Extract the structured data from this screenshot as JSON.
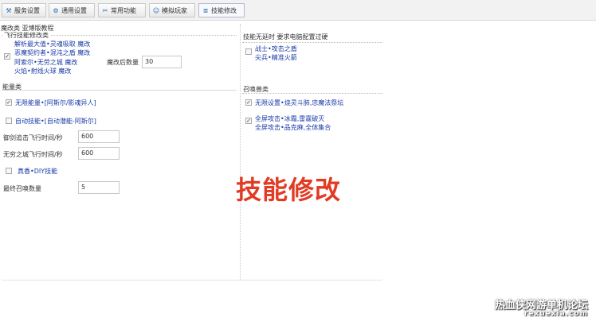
{
  "toolbar": {
    "tabs": [
      {
        "label": "服务设置",
        "icon": "wrench-icon"
      },
      {
        "label": "通用设置",
        "icon": "settings-icon"
      },
      {
        "label": "常用功能",
        "icon": "tools-icon"
      },
      {
        "label": "模拟玩家",
        "icon": "user-icon"
      },
      {
        "label": "技能修改",
        "icon": "skill-icon"
      }
    ],
    "active": "技能修改"
  },
  "header": "魔改类 亚博版教程",
  "flight_group": {
    "title": "飞行技能修改类",
    "checkbox_checked": true,
    "lines": [
      "解析最大值•灵魂吸取 魔改",
      "恶魔契约者•混沌之盾 魔改",
      "阿索尔•无劳之城 魔改",
      "火焰•射线火球 魔改"
    ],
    "count_label": "魔改后数量",
    "count_value": "30"
  },
  "ability_group": {
    "title": "能量类",
    "options": [
      {
        "label": "无限能量•[阿斯尔/影魂异人]",
        "checked": true
      },
      {
        "label": "自动技能•[自动潜能-阿斯尔]",
        "checked": false
      }
    ],
    "fields": [
      {
        "label": "御剑追击飞行时间/秒",
        "value": "600"
      },
      {
        "label": "无穷之城飞行时间/秒",
        "value": "600"
      }
    ],
    "extra_option": {
      "label": "真香•DIY技能",
      "checked": false
    },
    "summon_label": "最终召唤数量",
    "summon_value": "5"
  },
  "skill_infinite": {
    "title": "技能无延时 要求电脑配置过硬",
    "checked": false,
    "lines": [
      "战士•攻击之盾",
      "尖兵•精准火箭"
    ]
  },
  "summon_group": {
    "title": "召唤兽类",
    "options": [
      {
        "checked": true,
        "lines": [
          "无限设置•烧灵斗肺,忠魔法祭坛"
        ]
      },
      {
        "checked": true,
        "lines": [
          "全屏攻击•冰霜,雷霆破灭",
          "全屏攻击•品克麻,全体集合"
        ]
      }
    ]
  },
  "banner": "技能修改",
  "watermark": {
    "line1": "热血侠网游单机论坛",
    "line2": "rexuexia.com"
  }
}
